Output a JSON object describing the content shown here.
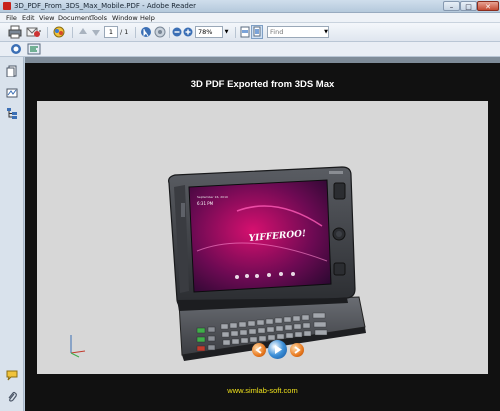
{
  "window": {
    "title": "3D_PDF_From_3DS_Max_Mobile.PDF - Adobe Reader",
    "minimize": "–",
    "maximize": "□",
    "close": "✕"
  },
  "menu": [
    "File",
    "Edit",
    "View",
    "Document",
    "Tools",
    "Window",
    "Help"
  ],
  "toolbar": {
    "page_current": "1",
    "page_total": "/ 1",
    "zoom": "78%",
    "find_placeholder": "Find"
  },
  "document": {
    "title": "3D PDF Exported from 3DS Max",
    "link": "www.simlab-soft.com"
  },
  "phone": {
    "brand_logo": "YIFFEROO!",
    "time": "6:31 PM",
    "date": "September 16, 2010"
  },
  "colors": {
    "page_bg": "#111111",
    "viewport_bg": "#d7d7d7",
    "link": "#f0e21b",
    "accent_nav": "#e8781e"
  }
}
